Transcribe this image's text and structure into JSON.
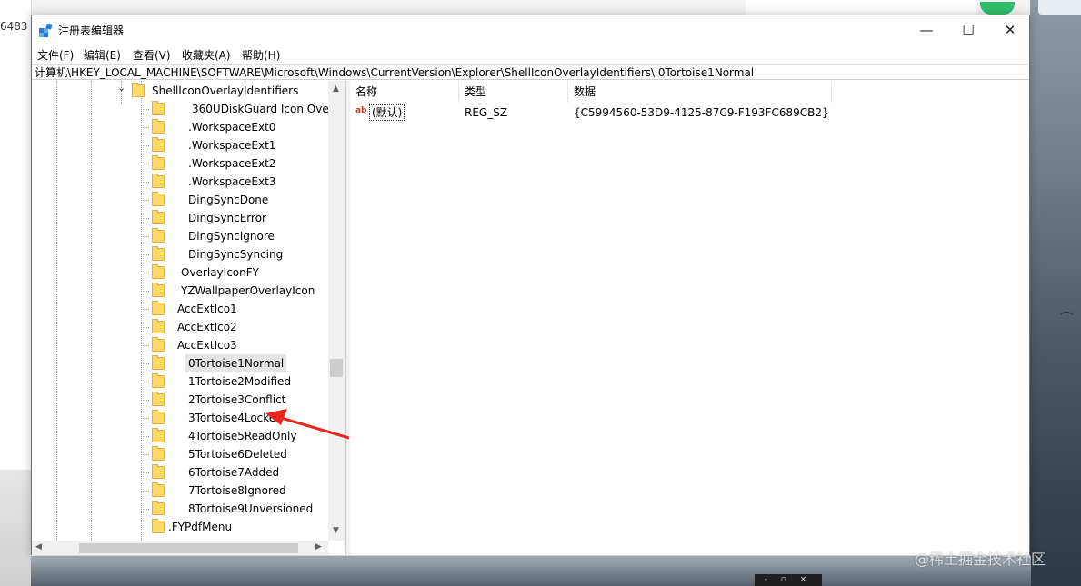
{
  "background": {
    "left_partial_text": "6483",
    "watermark": "@稀土掘金技术社区",
    "taskbar_mini": "- ▫ ×"
  },
  "window": {
    "title": "注册表编辑器",
    "controls": {
      "minimize": "—",
      "maximize": "☐",
      "close": "✕"
    }
  },
  "menu": [
    "文件(F)",
    "编辑(E)",
    "查看(V)",
    "收藏夹(A)",
    "帮助(H)"
  ],
  "address": "计算机\\HKEY_LOCAL_MACHINE\\SOFTWARE\\Microsoft\\Windows\\CurrentVersion\\Explorer\\ShellIconOverlayIdentifiers\\      0Tortoise1Normal",
  "tree": {
    "parent": "ShellIconOverlayIdentifiers",
    "items": [
      " 360UDiskGuard Icon Ove",
      ".WorkspaceExt0",
      ".WorkspaceExt1",
      ".WorkspaceExt2",
      ".WorkspaceExt3",
      "DingSyncDone",
      "DingSyncError",
      "DingSyncIgnore",
      "DingSyncSyncing",
      "OverlayIconFY",
      "YZWallpaperOverlayIcon",
      "AccExtIco1",
      "AccExtIco2",
      "AccExtIco3",
      "0Tortoise1Normal",
      "1Tortoise2Modified",
      "2Tortoise3Conflict",
      "3Tortoise4Locked",
      "4Tortoise5ReadOnly",
      "5Tortoise6Deleted",
      "6Tortoise7Added",
      "7Tortoise8Ignored",
      "8Tortoise9Unversioned"
    ],
    "sibling": ".FYPdfMenu",
    "selected": "0Tortoise1Normal"
  },
  "list": {
    "columns": {
      "name": "名称",
      "type": "类型",
      "data": "数据"
    },
    "rows": [
      {
        "name": "(默认)",
        "type": "REG_SZ",
        "data": "{C5994560-53D9-4125-87C9-F193FC689CB2}"
      }
    ]
  },
  "annotation": {
    "arrow_color": "#e8261f"
  }
}
